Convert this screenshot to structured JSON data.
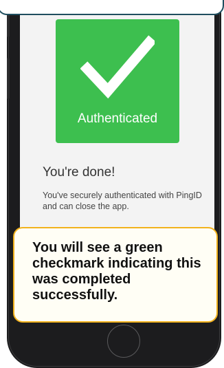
{
  "screen": {
    "auth_card": {
      "label": "Authenticated",
      "icon": "checkmark-icon",
      "color": "#3dbf4f"
    },
    "done_title": "You're done!",
    "done_body": "You've securely authenticated with PingID and can close the app."
  },
  "tooltip": {
    "text": "You will see a green checkmark indicating this was completed successfully.",
    "border_color": "#f2b21c"
  },
  "callout_border_color": "#1f4e5f"
}
